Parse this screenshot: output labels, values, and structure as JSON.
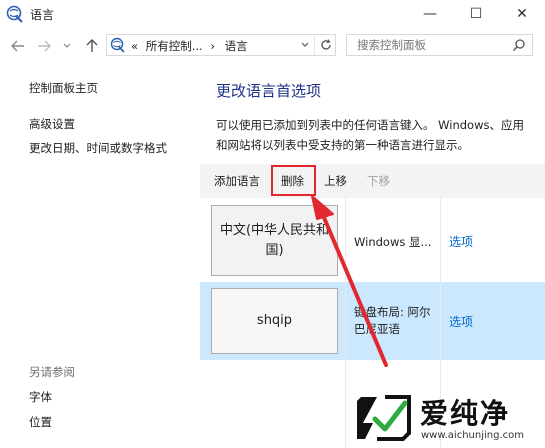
{
  "window": {
    "title": "语言",
    "minimize_glyph": "—",
    "maximize_glyph": "☐",
    "close_glyph": "✕"
  },
  "nav": {
    "back_icon": "arrow-left-icon",
    "forward_icon": "arrow-right-icon",
    "recent_icon": "chevron-down-icon",
    "up_icon": "arrow-up-icon"
  },
  "address": {
    "prefix": "«",
    "crumb1": "所有控制...",
    "separator": "›",
    "crumb2": "语言"
  },
  "search": {
    "placeholder": "搜索控制面板"
  },
  "sidebar": {
    "items": [
      {
        "label": "控制面板主页"
      },
      {
        "label": "高级设置"
      },
      {
        "label": "更改日期、时间或数字格式"
      }
    ],
    "see_also_heading": "另请参阅",
    "see_also": [
      {
        "label": "字体"
      },
      {
        "label": "位置"
      }
    ]
  },
  "main": {
    "title": "更改语言首选项",
    "description": "可以使用已添加到列表中的任何语言键入。 Windows、应用和网站将以列表中受支持的第一种语言进行显示。",
    "toolbar": {
      "add": "添加语言",
      "remove": "删除",
      "move_up": "上移",
      "move_down": "下移"
    },
    "languages": [
      {
        "name": "中文(中华人民共和国)",
        "info": "Windows 显...",
        "options": "选项"
      },
      {
        "name": "shqip",
        "info": "键盘布局: 阿尔巴尼亚语",
        "options": "选项"
      }
    ]
  },
  "annotation_color": "#e0282e",
  "watermark": {
    "title": "爱纯净",
    "url": "www.aichunjing.com"
  }
}
